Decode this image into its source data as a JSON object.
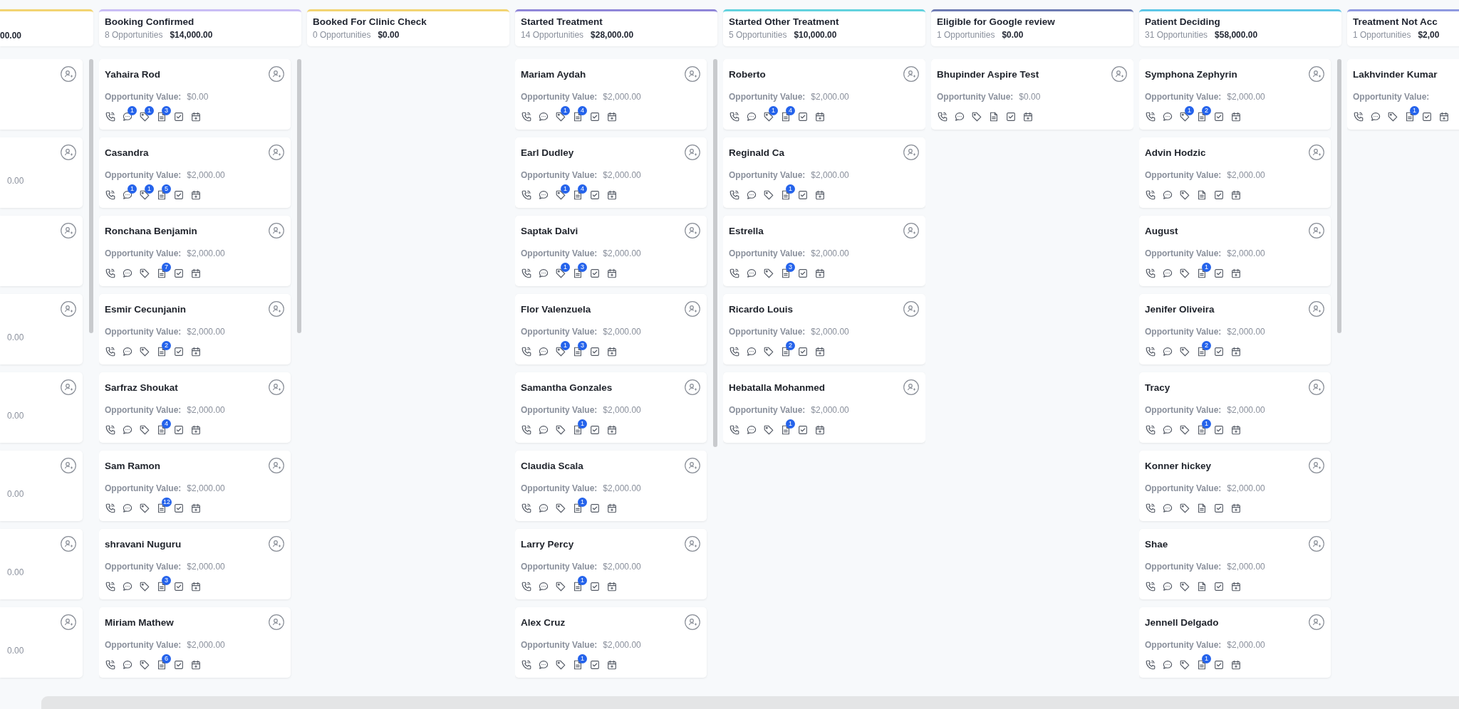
{
  "columns": [
    {
      "kind": "partial",
      "color": "#f2d472",
      "amount": "00.00",
      "cards": [
        {
          "kind": "cut"
        },
        {
          "kind": "cut",
          "value": "0.00"
        },
        {
          "kind": "cut"
        },
        {
          "kind": "cut",
          "value": "0.00"
        },
        {
          "kind": "cut",
          "value": "0.00"
        },
        {
          "kind": "cut",
          "value": "0.00"
        },
        {
          "kind": "cut",
          "value": "0.00"
        },
        {
          "kind": "cut",
          "value": "0.00"
        }
      ]
    },
    {
      "kind": "full",
      "color": "#c9bdf5",
      "title": "Booking Confirmed",
      "count": "8 Opportunities",
      "amount": "$14,000.00",
      "cards": [
        {
          "name": "Yahaira Rod",
          "label": "Opportunity Value:",
          "value": "$0.00",
          "badges": {
            "chat": "1",
            "tag": "1",
            "notes": "3"
          }
        },
        {
          "name": "Casandra",
          "label": "Opportunity Value:",
          "value": "$2,000.00",
          "badges": {
            "chat": "1",
            "tag": "1",
            "notes": "5"
          }
        },
        {
          "name": "Ronchana Benjamin",
          "label": "Opportunity Value:",
          "value": "$2,000.00",
          "badges": {
            "notes": "7"
          }
        },
        {
          "name": "Esmir Cecunjanin",
          "label": "Opportunity Value:",
          "value": "$2,000.00",
          "badges": {
            "notes": "2"
          }
        },
        {
          "name": "Sarfraz Shoukat",
          "label": "Opportunity Value:",
          "value": "$2,000.00",
          "badges": {
            "notes": "4"
          }
        },
        {
          "name": "Sam Ramon",
          "label": "Opportunity Value:",
          "value": "$2,000.00",
          "badges": {
            "notes": "12"
          }
        },
        {
          "name": "shravani Nuguru",
          "label": "Opportunity Value:",
          "value": "$2,000.00",
          "badges": {
            "notes": "3"
          }
        },
        {
          "name": "Miriam Mathew",
          "label": "Opportunity Value:",
          "value": "$2,000.00",
          "badges": {
            "notes": "6"
          }
        }
      ]
    },
    {
      "kind": "full",
      "color": "#f2d472",
      "title": "Booked For Clinic Check",
      "count": "0 Opportunities",
      "amount": "$0.00"
    },
    {
      "kind": "full",
      "color": "#8f86d8",
      "title": "Started Treatment",
      "count": "14 Opportunities",
      "amount": "$28,000.00",
      "cards": [
        {
          "name": "Mariam Aydah",
          "label": "Opportunity Value:",
          "value": "$2,000.00",
          "badges": {
            "tag": "1",
            "notes": "4"
          }
        },
        {
          "name": "Earl Dudley",
          "label": "Opportunity Value:",
          "value": "$2,000.00",
          "badges": {
            "tag": "1",
            "notes": "4"
          }
        },
        {
          "name": "Saptak Dalvi",
          "label": "Opportunity Value:",
          "value": "$2,000.00",
          "badges": {
            "tag": "1",
            "notes": "3"
          }
        },
        {
          "name": "Flor Valenzuela",
          "label": "Opportunity Value:",
          "value": "$2,000.00",
          "badges": {
            "tag": "1",
            "notes": "3"
          }
        },
        {
          "name": "Samantha Gonzales",
          "label": "Opportunity Value:",
          "value": "$2,000.00",
          "badges": {
            "notes": "1"
          }
        },
        {
          "name": "Claudia Scala",
          "label": "Opportunity Value:",
          "value": "$2,000.00",
          "badges": {
            "notes": "1"
          }
        },
        {
          "name": "Larry Percy",
          "label": "Opportunity Value:",
          "value": "$2,000.00",
          "badges": {
            "notes": "1"
          }
        },
        {
          "name": "Alex Cruz",
          "label": "Opportunity Value:",
          "value": "$2,000.00",
          "badges": {
            "notes": "1"
          }
        }
      ]
    },
    {
      "kind": "full",
      "color": "#62d2de",
      "title": "Started Other Treatment",
      "count": "5 Opportunities",
      "amount": "$10,000.00",
      "cards": [
        {
          "name": "Roberto",
          "label": "Opportunity Value:",
          "value": "$2,000.00",
          "badges": {
            "tag": "1",
            "notes": "4"
          }
        },
        {
          "name": "Reginald Ca",
          "label": "Opportunity Value:",
          "value": "$2,000.00",
          "badges": {
            "notes": "1"
          }
        },
        {
          "name": "Estrella",
          "label": "Opportunity Value:",
          "value": "$2,000.00",
          "badges": {
            "notes": "3"
          }
        },
        {
          "name": "Ricardo Louis",
          "label": "Opportunity Value:",
          "value": "$2,000.00",
          "badges": {
            "notes": "2"
          }
        },
        {
          "name": "Hebatalla Mohanmed",
          "label": "Opportunity Value:",
          "value": "$2,000.00",
          "badges": {
            "notes": "1"
          }
        }
      ]
    },
    {
      "kind": "full",
      "color": "#6d7bb3",
      "title": "Eligible for Google review",
      "count": "1 Opportunities",
      "amount": "$0.00",
      "cards": [
        {
          "name": "Bhupinder Aspire Test",
          "label": "Opportunity Value:",
          "value": "$0.00"
        }
      ]
    },
    {
      "kind": "full",
      "color": "#5cc6e6",
      "title": "Patient Deciding",
      "count": "31 Opportunities",
      "amount": "$58,000.00",
      "cards": [
        {
          "name": "Symphona Zephyrin",
          "label": "Opportunity Value:",
          "value": "$2,000.00",
          "badges": {
            "tag": "1",
            "notes": "2"
          }
        },
        {
          "name": "Advin Hodzic",
          "label": "Opportunity Value:",
          "value": "$2,000.00"
        },
        {
          "name": "August",
          "label": "Opportunity Value:",
          "value": "$2,000.00",
          "badges": {
            "notes": "1"
          }
        },
        {
          "name": "Jenifer Oliveira",
          "label": "Opportunity Value:",
          "value": "$2,000.00",
          "badges": {
            "notes": "2"
          }
        },
        {
          "name": "Tracy",
          "label": "Opportunity Value:",
          "value": "$2,000.00",
          "badges": {
            "notes": "1"
          }
        },
        {
          "name": "Konner hickey",
          "label": "Opportunity Value:",
          "value": "$2,000.00"
        },
        {
          "name": "Shae",
          "label": "Opportunity Value:",
          "value": "$2,000.00"
        },
        {
          "name": "Jennell Delgado",
          "label": "Opportunity Value:",
          "value": "$2,000.00",
          "badges": {
            "notes": "1"
          }
        }
      ]
    },
    {
      "kind": "full",
      "color": "#8f9ae0",
      "title": "Treatment Not Acc",
      "count": "1 Opportunities",
      "amount": "$2,00",
      "cards": [
        {
          "name": "Lakhvinder Kumar",
          "label": "Opportunity Value:",
          "badges": {
            "notes": "1"
          }
        }
      ]
    }
  ]
}
